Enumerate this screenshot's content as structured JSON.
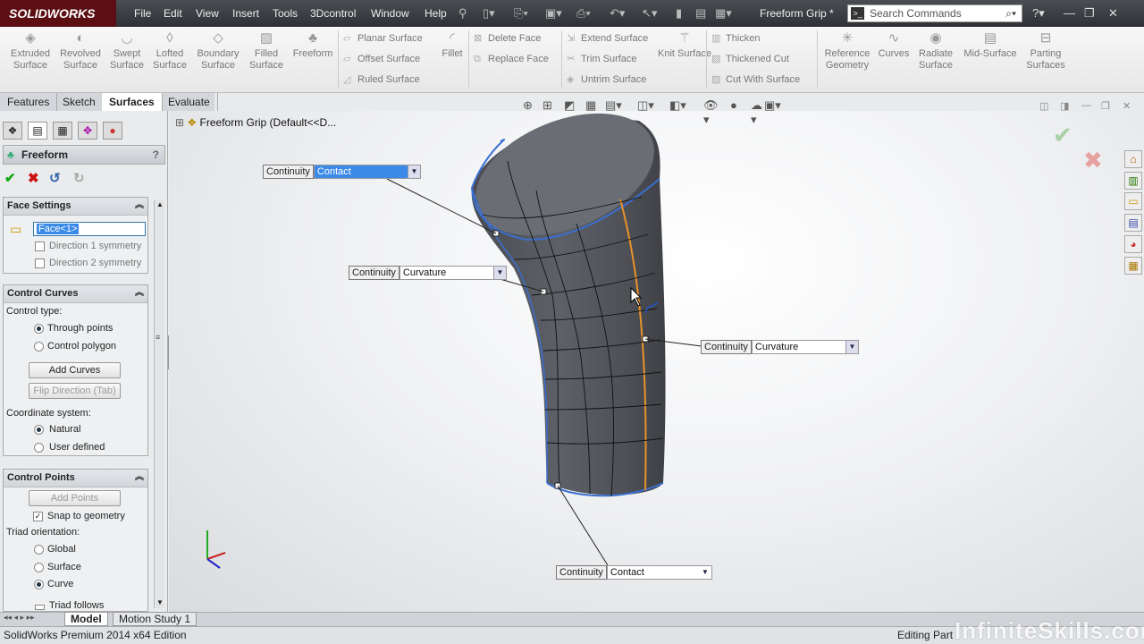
{
  "app": {
    "logo": "SOLIDWORKS",
    "doc_title": "Freeform Grip *"
  },
  "menu": [
    "File",
    "Edit",
    "View",
    "Insert",
    "Tools",
    "3Dcontrol",
    "Window",
    "Help"
  ],
  "search": {
    "placeholder": "Search Commands"
  },
  "cmd_large": [
    "Extruded Surface",
    "Revolved Surface",
    "Swept Surface",
    "Lofted Surface",
    "Boundary Surface",
    "Filled Surface",
    "Freeform",
    "Fillet",
    "Knit Surface",
    "Reference Geometry",
    "Curves",
    "Radiate Surface",
    "Mid-Surface",
    "Parting Surfaces"
  ],
  "cmd_small": [
    "Planar Surface",
    "Offset Surface",
    "Ruled Surface",
    "Delete Face",
    "Replace Face",
    "Extend Surface",
    "Trim Surface",
    "Untrim Surface",
    "Thicken",
    "Thickened Cut",
    "Cut With Surface"
  ],
  "tabs": [
    "Features",
    "Sketch",
    "Surfaces",
    "Evaluate"
  ],
  "feature": {
    "title": "Freeform"
  },
  "face_settings": {
    "title": "Face Settings",
    "face": "Face<1>",
    "dir1": "Direction 1 symmetry",
    "dir2": "Direction 2 symmetry"
  },
  "control_curves": {
    "title": "Control Curves",
    "type_label": "Control type:",
    "through_points": "Through points",
    "control_polygon": "Control polygon",
    "add_curves": "Add Curves",
    "flip": "Flip Direction (Tab)",
    "coord_label": "Coordinate system:",
    "natural": "Natural",
    "user_defined": "User defined"
  },
  "control_points": {
    "title": "Control Points",
    "add_points": "Add Points",
    "snap": "Snap to geometry",
    "triad_label": "Triad orientation:",
    "global": "Global",
    "surface": "Surface",
    "curve": "Curve",
    "triad_follows": "Triad follows"
  },
  "tree": {
    "root": "Freeform Grip  (Default<<D..."
  },
  "continuity": {
    "label": "Continuity",
    "top": "Contact",
    "left": "Curvature",
    "right": "Curvature",
    "bottom": "Contact"
  },
  "bottom_tabs": [
    "Model",
    "Motion Study 1"
  ],
  "status": {
    "left": "SolidWorks Premium 2014 x64 Edition",
    "right": "Editing Part"
  },
  "watermark": "InfiniteSkills.com"
}
